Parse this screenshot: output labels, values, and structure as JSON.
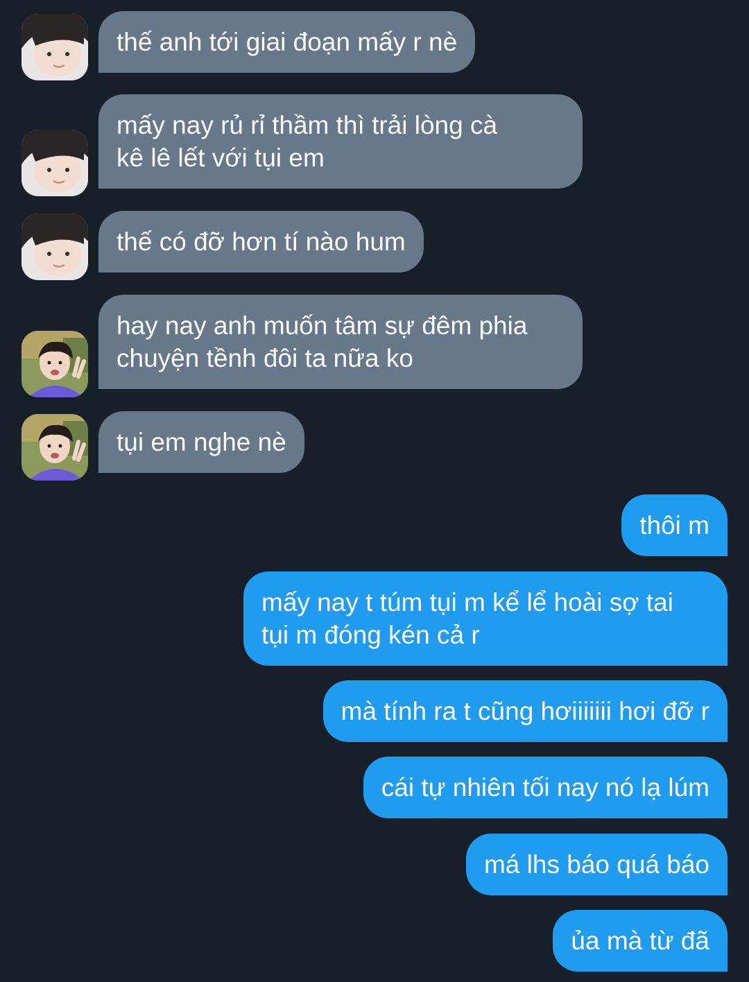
{
  "messages": [
    {
      "direction": "in",
      "avatar": "person-a",
      "lines": [
        "thế anh tới giai đoạn mấy r nè"
      ]
    },
    {
      "direction": "in",
      "avatar": "person-a",
      "lines": [
        "mấy nay rủ rỉ thầm thì trải lòng cà",
        "kê lê lết với tụi em"
      ]
    },
    {
      "direction": "in",
      "avatar": "person-a",
      "lines": [
        "thế có đỡ hơn tí nào hum"
      ]
    },
    {
      "direction": "in",
      "avatar": "person-b",
      "lines": [
        "hay nay anh muốn tâm sự đêm phia",
        "chuyện tềnh đôi ta nữa ko"
      ]
    },
    {
      "direction": "in",
      "avatar": "person-b",
      "lines": [
        "tụi em nghe nè"
      ]
    },
    {
      "direction": "out",
      "lines": [
        "thôi m"
      ]
    },
    {
      "direction": "out",
      "lines": [
        "mấy nay t túm tụi m kể lể hoài sợ tai",
        "tụi m đóng kén cả r"
      ]
    },
    {
      "direction": "out",
      "lines": [
        "mà tính ra t cũng hơiiiiiii hơi đỡ r"
      ]
    },
    {
      "direction": "out",
      "lines": [
        "cái tự nhiên tối nay nó lạ lúm"
      ]
    },
    {
      "direction": "out",
      "lines": [
        "má lhs báo quá báo"
      ]
    },
    {
      "direction": "out",
      "lines": [
        "ủa mà từ đã"
      ]
    }
  ],
  "colors": {
    "background": "#171f28",
    "incoming_bubble": "#66788a",
    "outgoing_bubble": "#1f9cf0",
    "text": "#ffffff"
  }
}
